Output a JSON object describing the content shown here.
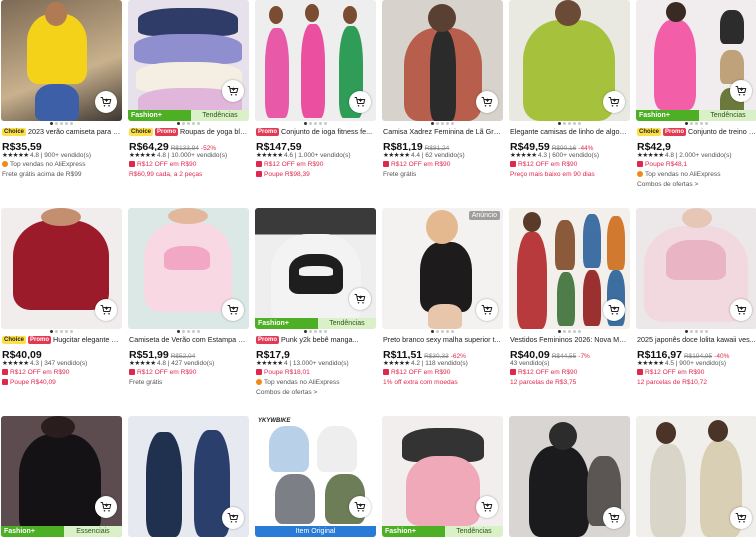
{
  "colors": {
    "accent_red": "#e0284c",
    "choice_yellow": "#fde047",
    "promo_red": "#e23a53",
    "fashion_green": "#4caf24",
    "tag_green_light": "#d9f0c8",
    "original_blue": "#2a7bd8"
  },
  "icons": {
    "cart": "shopping-cart-icon",
    "coupon": "coupon-icon",
    "top_sales": "top-sales-icon",
    "star": "star-icon"
  },
  "products": [
    {
      "badges": [
        "Choice"
      ],
      "title": "2023 verão camiseta para m...",
      "price": "R$35,59",
      "rating_value": 4.8,
      "rating": "4.8 | 900+ vendido(s)",
      "lines": [
        {
          "icon": "top_sales",
          "text": "Top vendas no AliExpress",
          "style": "gray"
        },
        {
          "text": "Frete grátis acima de R$99",
          "style": "gray"
        }
      ]
    },
    {
      "badges": [
        "Choice",
        "Promo"
      ],
      "title": "Roupas de yoga blusã...",
      "price": "R$64,29",
      "old_price": "R$133,94",
      "discount": "-52%",
      "rating_value": 4.8,
      "rating": "4.8 | 10.000+ vendido(s)",
      "strip": {
        "left": "Fashion+",
        "right": "Tendências"
      },
      "lines": [
        {
          "icon": "coupon",
          "text": "R$12 OFF em R$90",
          "style": "red"
        },
        {
          "text": "R$60,99 cada, a 2 peças",
          "style": "red"
        }
      ]
    },
    {
      "badges": [
        "Promo"
      ],
      "title": "Conjunto de ioga fitness fe...",
      "price": "R$147,59",
      "rating_value": 4.6,
      "rating": "4.6 | 1.000+ vendido(s)",
      "lines": [
        {
          "icon": "coupon",
          "text": "R$12 OFF em R$90",
          "style": "red"
        },
        {
          "icon": "coupon",
          "text": "Poupe R$98,39",
          "style": "red"
        }
      ]
    },
    {
      "badges": [],
      "title": "Camisa Xadrez Feminina de Lã Gro...",
      "price": "R$81,19",
      "old_price": "R$81,24",
      "rating_value": 4.4,
      "rating": "4.4 | 62 vendido(s)",
      "lines": [
        {
          "icon": "coupon",
          "text": "R$12 OFF em R$90",
          "style": "red"
        },
        {
          "text": "Frete grátis",
          "style": "gray"
        }
      ]
    },
    {
      "badges": [],
      "title": "Elegante camisas de linho de algod...",
      "price": "R$49,59",
      "old_price": "R$90,16",
      "discount": "-44%",
      "rating_value": 4.3,
      "rating": "4.3 | 600+ vendido(s)",
      "lines": [
        {
          "icon": "coupon",
          "text": "R$12 OFF em R$90",
          "style": "red"
        },
        {
          "text": "Preço mais baixo em 90 dias",
          "style": "red"
        }
      ]
    },
    {
      "badges": [
        "Choice",
        "Promo"
      ],
      "title": "Conjunto de treino cu...",
      "price": "R$42,9",
      "rating_value": 4.8,
      "rating": "4.8 | 2.000+ vendido(s)",
      "strip": {
        "left": "Fashion+",
        "right": "Tendências"
      },
      "lines": [
        {
          "icon": "coupon",
          "text": "Poupe R$48,1",
          "style": "red"
        },
        {
          "icon": "top_sales",
          "text": "Top vendas no AliExpress",
          "style": "gray"
        },
        {
          "text": "Combos de ofertas >",
          "style": "gray"
        }
      ]
    },
    {
      "badges": [
        "Choice",
        "Promo"
      ],
      "title": "Hugcitar elegante ma...",
      "price": "R$40,09",
      "rating_value": 4.3,
      "rating": "4.3 | 347 vendido(s)",
      "lines": [
        {
          "icon": "coupon",
          "text": "R$12 OFF em R$90",
          "style": "red"
        },
        {
          "icon": "coupon",
          "text": "Poupe R$40,09",
          "style": "red"
        }
      ]
    },
    {
      "badges": [],
      "title": "Camiseta de Verão com Estampa d...",
      "price": "R$51,99",
      "old_price": "R$52,04",
      "rating_value": 4.8,
      "rating": "4.8 | 427 vendido(s)",
      "lines": [
        {
          "icon": "coupon",
          "text": "R$12 OFF em R$90",
          "style": "red"
        },
        {
          "text": "Frete grátis",
          "style": "gray"
        }
      ]
    },
    {
      "badges": [
        "Promo"
      ],
      "title": "Punk y2k bebê manga...",
      "price": "R$17,9",
      "rating_value": 4.0,
      "rating": "4 | 13.000+ vendido(s)",
      "strip": {
        "left": "Fashion+",
        "right": "Tendências"
      },
      "lines": [
        {
          "icon": "coupon",
          "text": "Poupe R$18,01",
          "style": "red"
        },
        {
          "icon": "top_sales",
          "text": "Top vendas no AliExpress",
          "style": "gray"
        },
        {
          "text": "Combos de ofertas >",
          "style": "gray"
        }
      ]
    },
    {
      "badges": [],
      "ad": "Anúncio",
      "title": "Preto branco sexy malha superior t...",
      "price": "R$11,51",
      "old_price": "R$30,33",
      "discount": "-62%",
      "rating_value": 4.2,
      "rating": "4.2 | 118 vendido(s)",
      "lines": [
        {
          "icon": "coupon",
          "text": "R$12 OFF em R$90",
          "style": "red"
        },
        {
          "text": "1% off extra com moedas",
          "style": "red"
        }
      ]
    },
    {
      "badges": [],
      "title": "Vestidos Femininos 2026: Nova Mo...",
      "price": "R$40,09",
      "old_price": "R$44,55",
      "discount": "-7%",
      "rating": "43 vendido(s)",
      "lines": [
        {
          "icon": "coupon",
          "text": "R$12 OFF em R$90",
          "style": "red"
        },
        {
          "text": "12 parcelas de R$3,75",
          "style": "red"
        }
      ]
    },
    {
      "badges": [],
      "title": "2025 japonês doce lolita kawaii ves...",
      "price": "R$116,97",
      "old_price": "R$194,95",
      "discount": "-40%",
      "rating_value": 4.5,
      "rating": "4.5 | 900+ vendido(s)",
      "lines": [
        {
          "icon": "coupon",
          "text": "R$12 OFF em R$90",
          "style": "red"
        },
        {
          "text": "12 parcelas de R$10,72",
          "style": "red"
        }
      ]
    },
    {
      "strip": {
        "left": "Fashion+",
        "right": "Essenciais"
      }
    },
    {},
    {
      "strip_original": "Item Original",
      "brand_logo": "YKYWBIKE"
    },
    {
      "strip": {
        "left": "Fashion+",
        "right": "Tendências"
      }
    },
    {},
    {}
  ]
}
